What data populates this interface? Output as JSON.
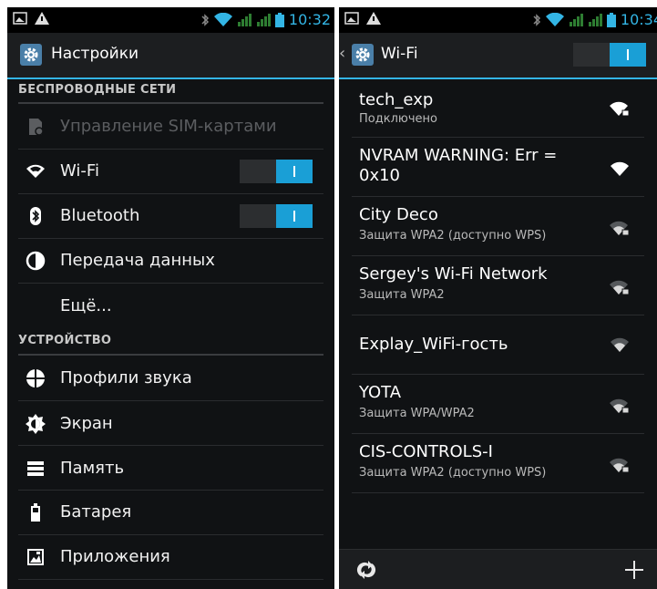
{
  "left": {
    "status": {
      "time": "10:32"
    },
    "title": "Настройки",
    "sections": {
      "wireless": "БЕСПРОВОДНЫЕ СЕТИ",
      "device": "УСТРОЙСТВО"
    },
    "items": {
      "sim": "Управление SIM-картами",
      "wifi": "Wi-Fi",
      "bluetooth": "Bluetooth",
      "data": "Передача данных",
      "more": "Ещё...",
      "sound": "Профили звука",
      "screen": "Экран",
      "memory": "Память",
      "battery": "Батарея",
      "apps": "Приложения"
    },
    "toggles": {
      "wifi": "on",
      "bluetooth": "on"
    }
  },
  "right": {
    "status": {
      "time": "10:34"
    },
    "title": "Wi-Fi",
    "toggle": "on",
    "networks": [
      {
        "name": "tech_exp",
        "status": "Подключено",
        "signal": "strong-secured"
      },
      {
        "name": "NVRAM WARNING: Err = 0x10",
        "status": "",
        "signal": "strong-open"
      },
      {
        "name": "City Deco",
        "status": "Защита WPA2 (доступно WPS)",
        "signal": "weak-secured"
      },
      {
        "name": "Sergey's Wi-Fi Network",
        "status": "Защита WPA2",
        "signal": "weak-secured"
      },
      {
        "name": "Explay_WiFi-гость",
        "status": "",
        "signal": "weak-open"
      },
      {
        "name": "YOTA",
        "status": "Защита WPA/WPA2",
        "signal": "weak-secured"
      },
      {
        "name": "CIS-CONTROLS-I",
        "status": "Защита WPA2 (доступно WPS)",
        "signal": "weak-secured"
      }
    ]
  },
  "colors": {
    "accent": "#33b5e5",
    "toggle_on": "#1a9fd6",
    "background": "#101214"
  }
}
